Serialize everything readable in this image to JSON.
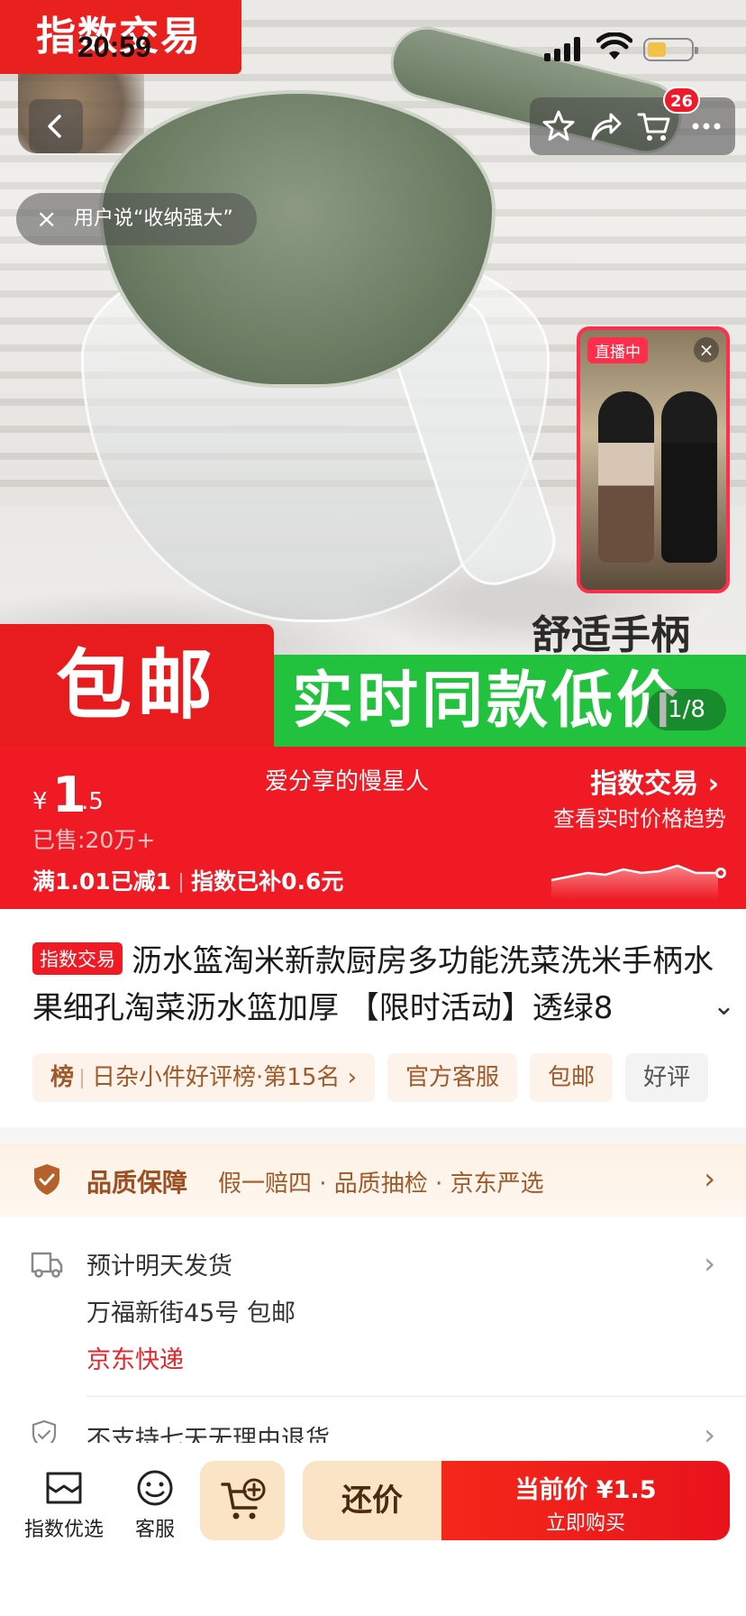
{
  "status_bar": {
    "time": "20:59"
  },
  "hero": {
    "corner_badge": "指数交易",
    "user_says": "用户说“收纳强大”",
    "user_says_close": "×",
    "cart_count": "26",
    "live": {
      "tag": "直播中",
      "close": "×"
    },
    "feature_label": "舒适手柄",
    "banner_red": "包邮",
    "banner_green": "实时同款低价",
    "pager": "1/8"
  },
  "price": {
    "currency": "¥",
    "integer": "1",
    "decimal": ".5",
    "sold": "已售:20万+",
    "promo_1": "满1.01已减1",
    "promo_2": "指数已补0.6元",
    "anchor_name": "爱分享的慢星人",
    "index_title": "指数交易",
    "index_sub": "查看实时价格趋势"
  },
  "product": {
    "tag": "指数交易",
    "title": "沥水篮淘米新款厨房多功能洗菜洗米手柄水果细孔淘菜沥水篮加厚 【限时活动】透绿8"
  },
  "chips": [
    {
      "prefix": "榜",
      "label": "日杂小件好评榜·第15名 ›"
    },
    {
      "label": "官方客服"
    },
    {
      "label": "包邮"
    },
    {
      "label": "好评"
    }
  ],
  "quality": {
    "label": "品质保障",
    "detail": "假一赔四 · 品质抽检 · 京东严选"
  },
  "shipping": {
    "eta": "预计明天发货",
    "address": "万福新街45号  包邮",
    "carrier": "京东快递"
  },
  "returns": {
    "text": "不支持七天无理由退货"
  },
  "bottom_bar": {
    "store_label": "指数优选",
    "service_label": "客服",
    "bargain_label": "还价",
    "buy_line1": "当前价 ¥1.5",
    "buy_line2": "立即购买"
  },
  "colors": {
    "brand_red": "#ef1a23",
    "promo_green": "#22c23e",
    "accent_orange": "#a0592b"
  },
  "icons": [
    "back-icon",
    "star-icon",
    "share-icon",
    "cart-icon",
    "more-icon",
    "shield-check-icon",
    "truck-icon",
    "store-icon",
    "service-icon",
    "add-cart-icon"
  ]
}
